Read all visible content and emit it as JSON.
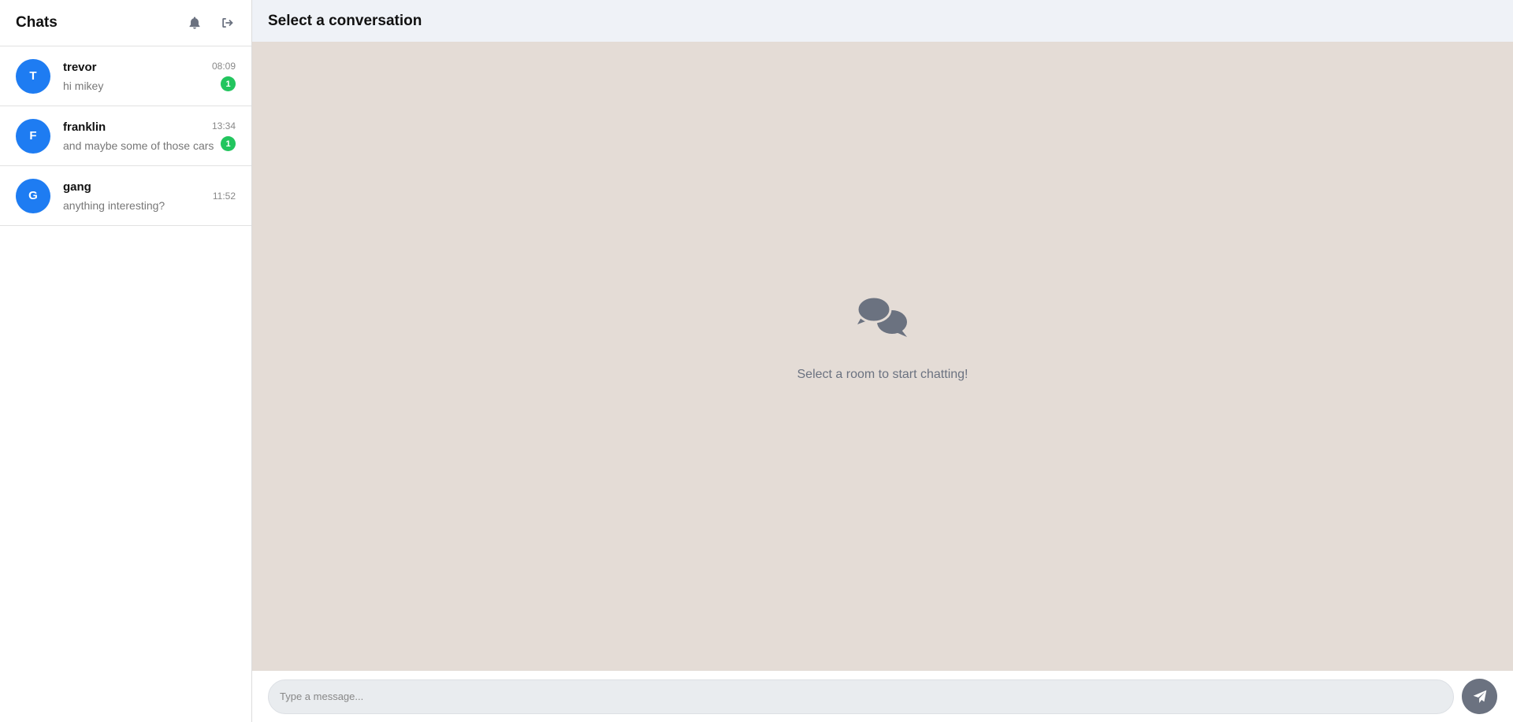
{
  "sidebar": {
    "title": "Chats",
    "notifications_icon": "bell-icon",
    "logout_icon": "logout-icon",
    "rooms": [
      {
        "initial": "T",
        "name": "trevor",
        "preview": "hi mikey",
        "time": "08:09",
        "unread": "1"
      },
      {
        "initial": "F",
        "name": "franklin",
        "preview": "and maybe some of those cars",
        "time": "13:34",
        "unread": "1"
      },
      {
        "initial": "G",
        "name": "gang",
        "preview": "anything interesting?",
        "time": "11:52",
        "unread": ""
      }
    ]
  },
  "main": {
    "title": "Select a conversation",
    "empty_icon": "chat-bubbles-icon",
    "empty_text": "Select a room to start chatting!"
  },
  "composer": {
    "placeholder": "Type a message...",
    "send_icon": "paper-plane-icon"
  },
  "colors": {
    "avatar": "#1e7cf2",
    "badge": "#22c55e",
    "chat_background": "#e4dcd6",
    "header_background": "#eff2f7",
    "icon_gray": "#6b7280"
  }
}
